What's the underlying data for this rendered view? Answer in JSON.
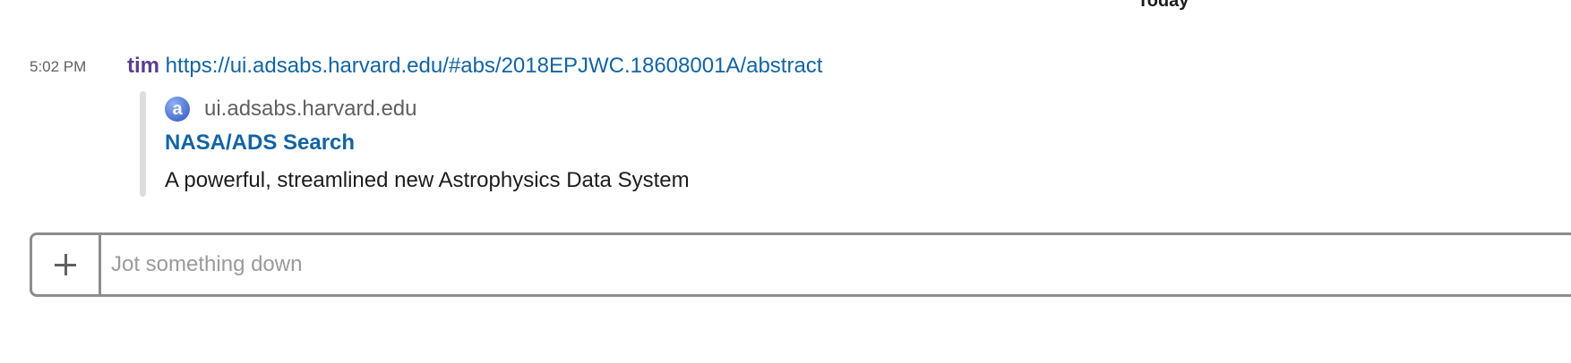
{
  "day_divider": {
    "label": "Today"
  },
  "message": {
    "timestamp": "5:02 PM",
    "sender": "tim",
    "link_text": "https://ui.adsabs.harvard.edu/#abs/2018EPJWC.18608001A/abstract",
    "unfurl": {
      "favicon_letter": "a",
      "site_name": "ui.adsabs.harvard.edu",
      "title": "NASA/ADS Search",
      "description": "A powerful, streamlined new Astrophysics Data System"
    }
  },
  "composer": {
    "attach_icon": "plus-icon",
    "placeholder": "Jot something down",
    "value": ""
  },
  "colors": {
    "sender": "#5b3f8c",
    "link": "#1264a3",
    "muted_text": "#616061",
    "unfurl_bar": "#dddddd",
    "composer_border": "#8d8d8d"
  }
}
